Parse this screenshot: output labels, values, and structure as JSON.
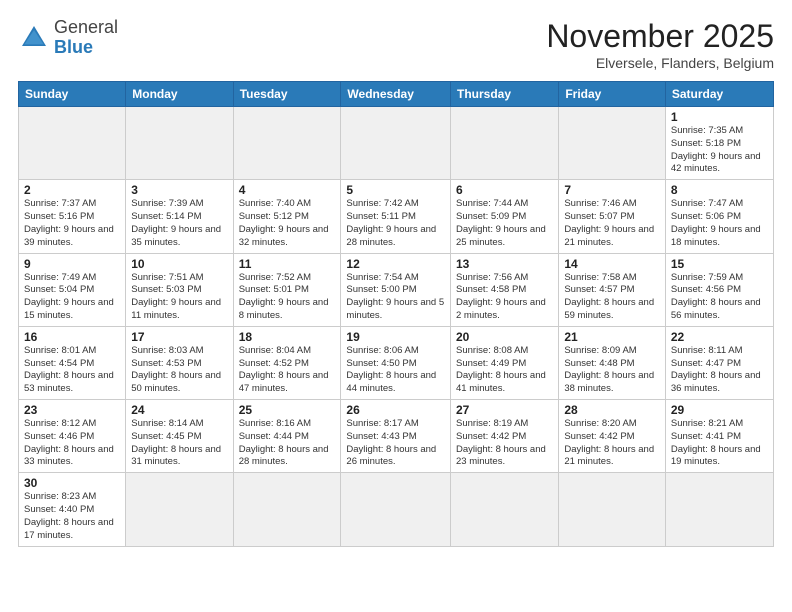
{
  "header": {
    "logo": {
      "general": "General",
      "blue": "Blue"
    },
    "title": "November 2025",
    "location": "Elversele, Flanders, Belgium"
  },
  "weekdays": [
    "Sunday",
    "Monday",
    "Tuesday",
    "Wednesday",
    "Thursday",
    "Friday",
    "Saturday"
  ],
  "weeks": [
    [
      {
        "day": "",
        "info": ""
      },
      {
        "day": "",
        "info": ""
      },
      {
        "day": "",
        "info": ""
      },
      {
        "day": "",
        "info": ""
      },
      {
        "day": "",
        "info": ""
      },
      {
        "day": "",
        "info": ""
      },
      {
        "day": "1",
        "info": "Sunrise: 7:35 AM\nSunset: 5:18 PM\nDaylight: 9 hours and 42 minutes."
      }
    ],
    [
      {
        "day": "2",
        "info": "Sunrise: 7:37 AM\nSunset: 5:16 PM\nDaylight: 9 hours and 39 minutes."
      },
      {
        "day": "3",
        "info": "Sunrise: 7:39 AM\nSunset: 5:14 PM\nDaylight: 9 hours and 35 minutes."
      },
      {
        "day": "4",
        "info": "Sunrise: 7:40 AM\nSunset: 5:12 PM\nDaylight: 9 hours and 32 minutes."
      },
      {
        "day": "5",
        "info": "Sunrise: 7:42 AM\nSunset: 5:11 PM\nDaylight: 9 hours and 28 minutes."
      },
      {
        "day": "6",
        "info": "Sunrise: 7:44 AM\nSunset: 5:09 PM\nDaylight: 9 hours and 25 minutes."
      },
      {
        "day": "7",
        "info": "Sunrise: 7:46 AM\nSunset: 5:07 PM\nDaylight: 9 hours and 21 minutes."
      },
      {
        "day": "8",
        "info": "Sunrise: 7:47 AM\nSunset: 5:06 PM\nDaylight: 9 hours and 18 minutes."
      }
    ],
    [
      {
        "day": "9",
        "info": "Sunrise: 7:49 AM\nSunset: 5:04 PM\nDaylight: 9 hours and 15 minutes."
      },
      {
        "day": "10",
        "info": "Sunrise: 7:51 AM\nSunset: 5:03 PM\nDaylight: 9 hours and 11 minutes."
      },
      {
        "day": "11",
        "info": "Sunrise: 7:52 AM\nSunset: 5:01 PM\nDaylight: 9 hours and 8 minutes."
      },
      {
        "day": "12",
        "info": "Sunrise: 7:54 AM\nSunset: 5:00 PM\nDaylight: 9 hours and 5 minutes."
      },
      {
        "day": "13",
        "info": "Sunrise: 7:56 AM\nSunset: 4:58 PM\nDaylight: 9 hours and 2 minutes."
      },
      {
        "day": "14",
        "info": "Sunrise: 7:58 AM\nSunset: 4:57 PM\nDaylight: 8 hours and 59 minutes."
      },
      {
        "day": "15",
        "info": "Sunrise: 7:59 AM\nSunset: 4:56 PM\nDaylight: 8 hours and 56 minutes."
      }
    ],
    [
      {
        "day": "16",
        "info": "Sunrise: 8:01 AM\nSunset: 4:54 PM\nDaylight: 8 hours and 53 minutes."
      },
      {
        "day": "17",
        "info": "Sunrise: 8:03 AM\nSunset: 4:53 PM\nDaylight: 8 hours and 50 minutes."
      },
      {
        "day": "18",
        "info": "Sunrise: 8:04 AM\nSunset: 4:52 PM\nDaylight: 8 hours and 47 minutes."
      },
      {
        "day": "19",
        "info": "Sunrise: 8:06 AM\nSunset: 4:50 PM\nDaylight: 8 hours and 44 minutes."
      },
      {
        "day": "20",
        "info": "Sunrise: 8:08 AM\nSunset: 4:49 PM\nDaylight: 8 hours and 41 minutes."
      },
      {
        "day": "21",
        "info": "Sunrise: 8:09 AM\nSunset: 4:48 PM\nDaylight: 8 hours and 38 minutes."
      },
      {
        "day": "22",
        "info": "Sunrise: 8:11 AM\nSunset: 4:47 PM\nDaylight: 8 hours and 36 minutes."
      }
    ],
    [
      {
        "day": "23",
        "info": "Sunrise: 8:12 AM\nSunset: 4:46 PM\nDaylight: 8 hours and 33 minutes."
      },
      {
        "day": "24",
        "info": "Sunrise: 8:14 AM\nSunset: 4:45 PM\nDaylight: 8 hours and 31 minutes."
      },
      {
        "day": "25",
        "info": "Sunrise: 8:16 AM\nSunset: 4:44 PM\nDaylight: 8 hours and 28 minutes."
      },
      {
        "day": "26",
        "info": "Sunrise: 8:17 AM\nSunset: 4:43 PM\nDaylight: 8 hours and 26 minutes."
      },
      {
        "day": "27",
        "info": "Sunrise: 8:19 AM\nSunset: 4:42 PM\nDaylight: 8 hours and 23 minutes."
      },
      {
        "day": "28",
        "info": "Sunrise: 8:20 AM\nSunset: 4:42 PM\nDaylight: 8 hours and 21 minutes."
      },
      {
        "day": "29",
        "info": "Sunrise: 8:21 AM\nSunset: 4:41 PM\nDaylight: 8 hours and 19 minutes."
      }
    ],
    [
      {
        "day": "30",
        "info": "Sunrise: 8:23 AM\nSunset: 4:40 PM\nDaylight: 8 hours and 17 minutes."
      },
      {
        "day": "",
        "info": ""
      },
      {
        "day": "",
        "info": ""
      },
      {
        "day": "",
        "info": ""
      },
      {
        "day": "",
        "info": ""
      },
      {
        "day": "",
        "info": ""
      },
      {
        "day": "",
        "info": ""
      }
    ]
  ]
}
